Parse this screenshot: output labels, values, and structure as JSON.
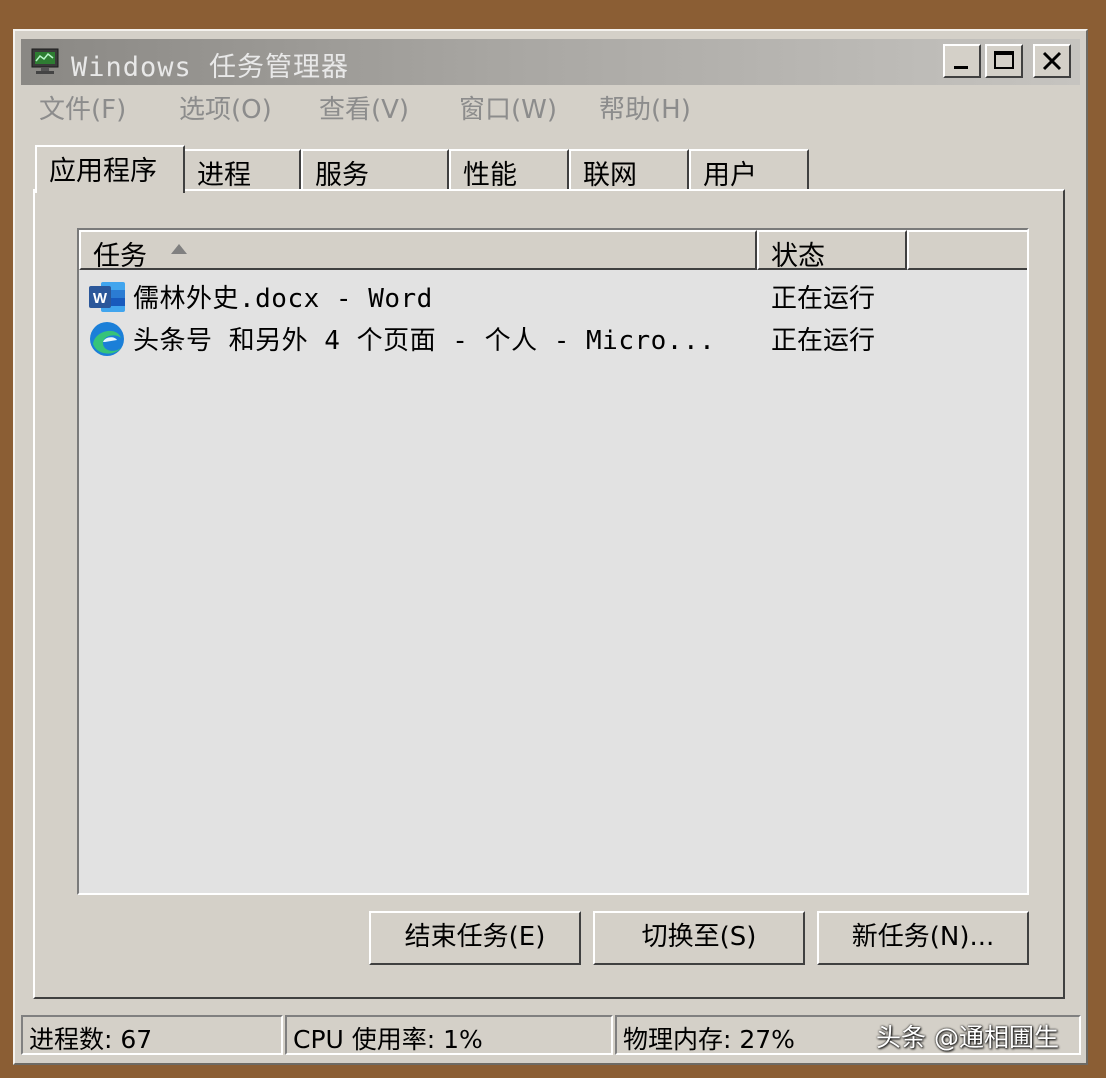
{
  "window": {
    "title": "Windows 任务管理器",
    "controls": {
      "minimize": "minimize",
      "maximize": "maximize",
      "close": "close"
    }
  },
  "menu": {
    "items": [
      "文件(F)",
      "选项(O)",
      "查看(V)",
      "窗口(W)",
      "帮助(H)"
    ]
  },
  "tabs": [
    "应用程序",
    "进程",
    "服务",
    "性能",
    "联网",
    "用户"
  ],
  "active_tab": "应用程序",
  "list": {
    "columns": {
      "task": "任务",
      "status": "状态",
      "sort": "ascending"
    },
    "rows": [
      {
        "icon": "word-icon",
        "name": "儒林外史.docx - Word",
        "status": "正在运行"
      },
      {
        "icon": "edge-icon",
        "name": "头条号 和另外 4 个页面 - 个人 - Micro...",
        "status": "正在运行"
      }
    ]
  },
  "buttons": {
    "end_task": "结束任务(E)",
    "switch_to": "切换至(S)",
    "new_task": "新任务(N)..."
  },
  "statusbar": {
    "processes": "进程数: 67",
    "cpu": "CPU 使用率: 1%",
    "memory": "物理内存: 27%"
  },
  "watermark": "头条 @通相圃生",
  "colors": {
    "background": "#8b5e34",
    "window": "#d4d0c8",
    "list_bg": "#e2e2e2",
    "word_blue": "#2b579a",
    "edge_blue": "#1b7fd8",
    "edge_green": "#36c37a"
  }
}
